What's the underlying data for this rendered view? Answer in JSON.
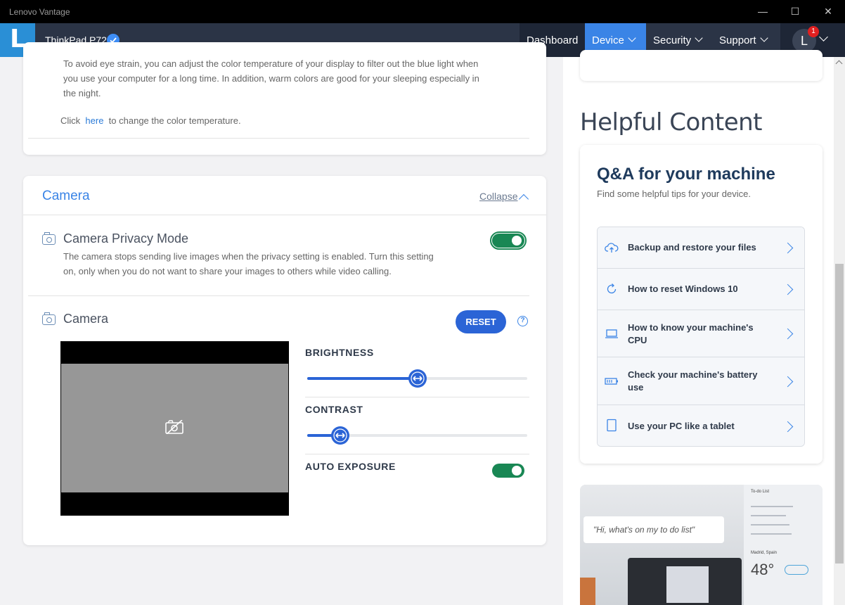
{
  "window": {
    "title": "Lenovo Vantage"
  },
  "header": {
    "logo_letter": "L",
    "device_name": "ThinkPad P72",
    "nav": {
      "dashboard": "Dashboard",
      "device": "Device",
      "security": "Security",
      "support": "Support"
    },
    "user_initial": "L",
    "notification_count": "1"
  },
  "eye_care": {
    "description": "To avoid eye strain, you can adjust the color temperature of your display to filter out the blue light when you use your computer for a long time. In addition, warm colors are good for your sleeping especially in the night.",
    "click_prefix": "Click",
    "link_text": "here",
    "click_suffix": "to change the color temperature."
  },
  "camera_section": {
    "title": "Camera",
    "collapse_label": "Collapse",
    "privacy": {
      "title": "Camera Privacy Mode",
      "description": "The camera stops sending live images when the privacy setting is enabled. Turn this setting on, only when you do not want to share your images to others while video calling.",
      "enabled": true
    },
    "camera": {
      "title": "Camera",
      "reset_label": "RESET",
      "help_glyph": "?"
    },
    "brightness": {
      "label": "BRIGHTNESS",
      "value": 50
    },
    "contrast": {
      "label": "CONTRAST",
      "value": 15
    },
    "auto_exposure": {
      "label": "AUTO EXPOSURE",
      "enabled": true
    }
  },
  "helpful": {
    "title": "Helpful Content",
    "qa_title": "Q&A for your machine",
    "qa_subtitle": "Find some helpful tips for your device.",
    "items": [
      {
        "label": "Backup and restore your files",
        "icon": "cloud-upload-icon"
      },
      {
        "label": "How to reset Windows 10",
        "icon": "refresh-icon"
      },
      {
        "label": "How to know your machine's CPU",
        "icon": "laptop-icon"
      },
      {
        "label": "Check your machine's battery use",
        "icon": "battery-icon"
      },
      {
        "label": "Use your PC like a tablet",
        "icon": "tablet-icon"
      }
    ],
    "promo": {
      "quote": "\"Hi, what's on my to do list\"",
      "todo_title": "To-do List",
      "city": "Madrid, Spain",
      "temperature": "48°"
    }
  },
  "colors": {
    "accent": "#3a84e6",
    "toggle_on": "#198754",
    "header_bg": "#2b3446",
    "reset_button": "#2b64d6"
  }
}
